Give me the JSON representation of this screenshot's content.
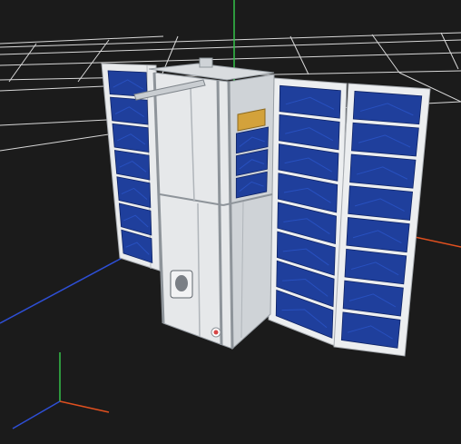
{
  "viewport": {
    "background": "#1b1b1b",
    "grid_color": "#d8d8d8"
  },
  "axes": {
    "x_color": "#e0501f",
    "y_color": "#34c34a",
    "z_color": "#2e4fd6"
  },
  "model": {
    "panel_color": "#1f3f9c",
    "cell_highlight": "#2a55c8",
    "body_color": "#e4e6e8",
    "frame_color": "#c7cbcf",
    "connector_color": "#d3a23b",
    "indicator_color": "#d64545"
  },
  "icons": {
    "orientation_gizmo": "axis-gizmo-icon"
  }
}
